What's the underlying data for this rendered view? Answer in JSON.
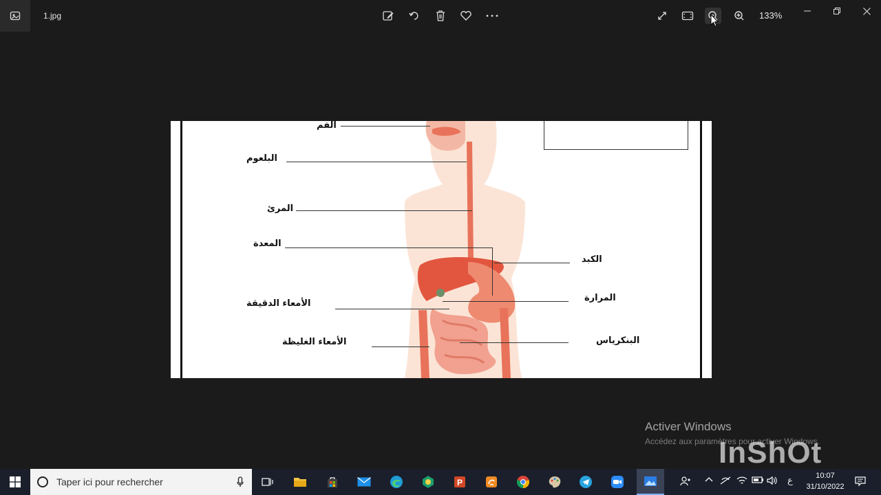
{
  "titlebar": {
    "file_name": "1.jpg",
    "zoom": "133%"
  },
  "diagram": {
    "labels_left": [
      "الفم",
      "البلعوم",
      "المرئ",
      "المعدة",
      "الأمعاء الدقيقة",
      "الأمعاء الغليظة"
    ],
    "labels_right": [
      "الكبد",
      "المرارة",
      "البنكرياس"
    ]
  },
  "watermark": {
    "title": "Activer Windows",
    "subtitle": "Accédez aux paramètres pour activer Windows.",
    "inshot": "InShOt"
  },
  "taskbar": {
    "search_placeholder": "Taper ici pour rechercher",
    "lang": "ع",
    "time": "10:07",
    "date": "31/10/2022"
  },
  "colors": {
    "background": "#1b1b1b",
    "taskbar": "#1a1f2b",
    "organ_red": "#e8735a",
    "skin": "#fbe4d6"
  }
}
